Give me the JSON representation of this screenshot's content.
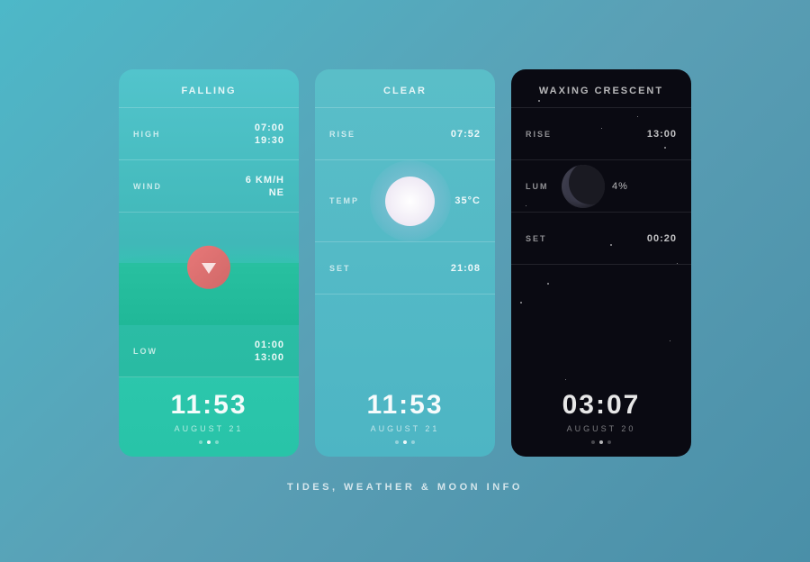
{
  "page": {
    "title": "TIDES, WEATHER & MOON INFO",
    "background": "#4db8c8"
  },
  "tides_card": {
    "header": "FALLING",
    "rows": {
      "high": {
        "label": "HIGH",
        "value1": "07:00",
        "value2": "19:30"
      },
      "wind": {
        "label": "WIND",
        "value1": "6 KM/H",
        "value2": "NE"
      },
      "low": {
        "label": "LOW",
        "value1": "01:00",
        "value2": "13:00"
      }
    },
    "time": "11:53",
    "date": "AUGUST 21",
    "dots": [
      false,
      true,
      false
    ]
  },
  "weather_card": {
    "header": "CLEAR",
    "rows": {
      "rise": {
        "label": "RISE",
        "value": "07:52"
      },
      "temp": {
        "label": "TEMP",
        "value": "35°C"
      },
      "set": {
        "label": "SET",
        "value": "21:08"
      }
    },
    "time": "11:53",
    "date": "AUGUST 21",
    "dots": [
      false,
      true,
      false
    ]
  },
  "moon_card": {
    "header": "WAXING CRESCENT",
    "rows": {
      "rise": {
        "label": "RISE",
        "value": "13:00"
      },
      "lum": {
        "label": "LUM",
        "value": "4%"
      },
      "set": {
        "label": "SET",
        "value": "00:20"
      }
    },
    "time": "03:07",
    "date": "AUGUST 20",
    "dots": [
      false,
      true,
      false
    ]
  },
  "icons": {
    "tide_arrow": "▼",
    "dot_active": "●",
    "dot_inactive": "●"
  }
}
